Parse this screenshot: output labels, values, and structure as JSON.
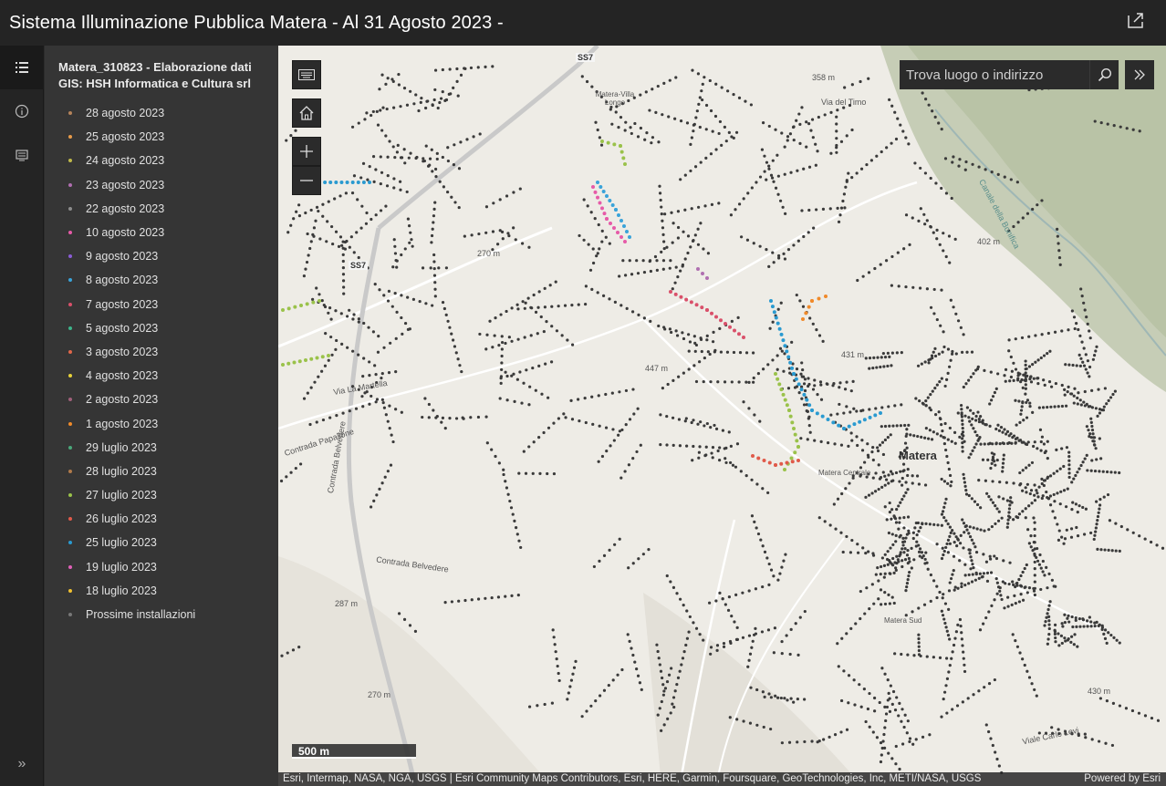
{
  "header": {
    "title": "Sistema Illuminazione Pubblica Matera - Al 31 Agosto 2023 -"
  },
  "rail": {
    "items": [
      {
        "icon": "legend-list-icon"
      },
      {
        "icon": "info-icon"
      },
      {
        "icon": "details-icon"
      }
    ],
    "expand_label": "»"
  },
  "panel": {
    "layer_title": "Matera_310823 - Elaborazione dati GIS: HSH Informatica e Cultura srl",
    "legend": [
      {
        "label": "28 agosto 2023",
        "color": "#b5835a"
      },
      {
        "label": "25 agosto 2023",
        "color": "#e89b4a"
      },
      {
        "label": "24 agosto 2023",
        "color": "#c0b94a"
      },
      {
        "label": "23 agosto 2023",
        "color": "#b06fb0"
      },
      {
        "label": "22 agosto 2023",
        "color": "#8c8c8c"
      },
      {
        "label": "10 agosto 2023",
        "color": "#e65aa8"
      },
      {
        "label": "9 agosto 2023",
        "color": "#8a5cd6"
      },
      {
        "label": "8 agosto 2023",
        "color": "#3aa3d9"
      },
      {
        "label": "7 agosto 2023",
        "color": "#d9506a"
      },
      {
        "label": "5 agosto 2023",
        "color": "#3db48a"
      },
      {
        "label": "3 agosto 2023",
        "color": "#e0674a"
      },
      {
        "label": "4 agosto 2023",
        "color": "#e8d23a"
      },
      {
        "label": "2 agosto 2023",
        "color": "#a0607a"
      },
      {
        "label": "1 agosto 2023",
        "color": "#f08a2a"
      },
      {
        "label": "29 luglio 2023",
        "color": "#4aa87a"
      },
      {
        "label": "28 luglio 2023",
        "color": "#b07a4a"
      },
      {
        "label": "27 luglio 2023",
        "color": "#9ac24a"
      },
      {
        "label": "26 luglio 2023",
        "color": "#e05a4a"
      },
      {
        "label": "25 luglio 2023",
        "color": "#2a9ad0"
      },
      {
        "label": "19 luglio 2023",
        "color": "#e060b8"
      },
      {
        "label": "18 luglio 2023",
        "color": "#f0c030"
      },
      {
        "label": "Prossime installazioni",
        "color": "#777777"
      }
    ]
  },
  "map": {
    "search": {
      "placeholder": "Trova luogo o indirizzo"
    },
    "scale_label": "500 m",
    "attribution": "Esri, Intermap, NASA, NGA, USGS | Esri Community Maps Contributors, Esri, HERE, Garmin, Foursquare, GeoTechnologies, Inc, METI/NASA, USGS",
    "powered_by": "Powered by Esri",
    "labels": {
      "ss7": "SS7",
      "villa_longo": "Matera-Villa Longo",
      "m358": "358 m",
      "via_timo": "Via del Timo",
      "ss7b": "SS7",
      "m270a": "270 m",
      "via_marsala": "Via La Martella",
      "contrada_papalione": "Contrada Papalione",
      "m447": "447 m",
      "matera": "Matera",
      "matera_centrale": "Matera Centrale",
      "contrada_belvedere": "Contrada Belvedere",
      "contrada_belvedere2": "Contrada Belvedere",
      "m287": "287 m",
      "m270b": "270 m",
      "matera_sud": "Matera Sud",
      "m402": "402 m",
      "m430": "430 m",
      "via_carlo_levi": "Viale Carlo Levi",
      "canale": "Canale della Bonifica",
      "m431": "431 m"
    }
  }
}
